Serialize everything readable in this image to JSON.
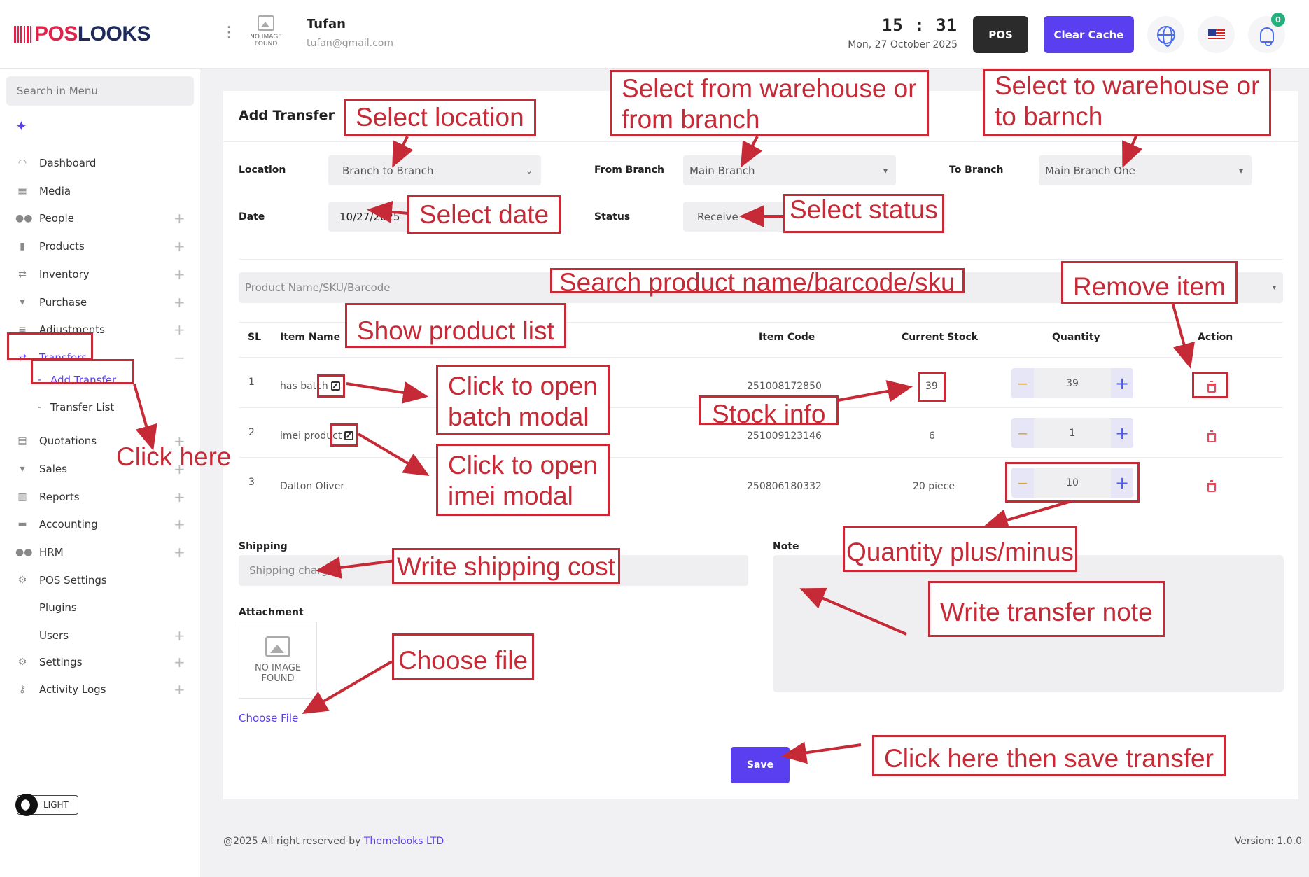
{
  "header": {
    "logo_pos": "POS",
    "logo_looks": "LOOKS",
    "no_image_line1": "NO IMAGE",
    "no_image_line2": "FOUND",
    "user_name": "Tufan",
    "user_email": "tufan@gmail.com",
    "time": "15 : 31",
    "date": "Mon, 27 October 2025",
    "pos_label": "POS",
    "clear_cache_label": "Clear Cache",
    "notification_count": "0"
  },
  "sidebar": {
    "search_placeholder": "Search in Menu",
    "items": [
      {
        "label": "Dashboard",
        "icon": "dashboard-icon"
      },
      {
        "label": "Media",
        "icon": "media-icon"
      },
      {
        "label": "People",
        "icon": "people-icon"
      },
      {
        "label": "Products",
        "icon": "products-icon"
      },
      {
        "label": "Inventory",
        "icon": "inventory-icon"
      },
      {
        "label": "Purchase",
        "icon": "cart-icon"
      },
      {
        "label": "Adjustments",
        "icon": "adjustments-icon"
      },
      {
        "label": "Transfers",
        "icon": "transfer-icon"
      },
      {
        "label": "Quotations",
        "icon": "document-icon"
      },
      {
        "label": "Sales",
        "icon": "cart-icon"
      },
      {
        "label": "Reports",
        "icon": "reports-icon"
      },
      {
        "label": "Accounting",
        "icon": "briefcase-icon"
      },
      {
        "label": "HRM",
        "icon": "people-icon"
      },
      {
        "label": "POS Settings",
        "icon": "gear-icon"
      },
      {
        "label": "Plugins",
        "icon": ""
      },
      {
        "label": "Users",
        "icon": ""
      },
      {
        "label": "Settings",
        "icon": "gears-icon"
      },
      {
        "label": "Activity Logs",
        "icon": "key-icon"
      }
    ],
    "sub_items": [
      "Add Transfer",
      "Transfer List"
    ],
    "theme_label": "LIGHT"
  },
  "form": {
    "title": "Add Transfer",
    "location_label": "Location",
    "location_value": "Branch to Branch",
    "from_label": "From Branch",
    "from_value": "Main Branch",
    "to_label": "To Branch",
    "to_value": "Main Branch One",
    "date_label": "Date",
    "date_value": "10/27/2025",
    "status_label": "Status",
    "status_value": "Receive",
    "search_placeholder": "Product Name/SKU/Barcode"
  },
  "table": {
    "headers": [
      "SL",
      "Item Name",
      "Item Code",
      "Current Stock",
      "Quantity",
      "Action"
    ],
    "rows": [
      {
        "sl": "1",
        "name": "has batch",
        "code": "251008172850",
        "stock": "39",
        "qty": "39"
      },
      {
        "sl": "2",
        "name": "imei product",
        "code": "251009123146",
        "stock": "6",
        "qty": "1"
      },
      {
        "sl": "3",
        "name": "Dalton Oliver",
        "code": "250806180332",
        "stock": "20 piece",
        "qty": "10"
      }
    ]
  },
  "bottom": {
    "shipping_label": "Shipping",
    "shipping_placeholder": "Shipping charge",
    "note_label": "Note",
    "attachment_label": "Attachment",
    "no_image_line1": "NO IMAGE",
    "no_image_line2": "FOUND",
    "choose_file": "Choose File",
    "save_label": "Save"
  },
  "footer": {
    "copyright": "@2025 All right reserved by",
    "company": "Themelooks LTD",
    "version": "Version: 1.0.0"
  },
  "annotations": {
    "select_location": "Select location",
    "from_warehouse_1": "Select from warehouse or",
    "from_warehouse_2": "from branch",
    "to_warehouse_1": "Select to warehouse or",
    "to_warehouse_2": "to barnch",
    "select_date": "Select date",
    "select_status": "Select status",
    "search_product": "Search product name/barcode/sku",
    "remove_item": "Remove item",
    "show_product_list": "Show product list",
    "batch_modal_1": "Click to open",
    "batch_modal_2": "batch modal",
    "stock_info": "Stock info",
    "imei_modal_1": "Click to open",
    "imei_modal_2": "imei modal",
    "click_here": "Click here",
    "qty_plus_minus": "Quantity plus/minus",
    "shipping_cost": "Write shipping cost",
    "transfer_note": "Write transfer note",
    "choose_file": "Choose file",
    "save_transfer": "Click here then save transfer"
  }
}
